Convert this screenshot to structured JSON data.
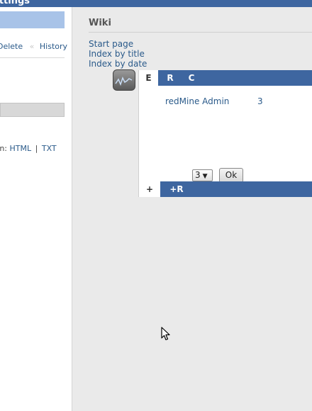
{
  "topbar": {
    "title": "ettings"
  },
  "left": {
    "actions": {
      "delete": "Delete",
      "history": "History"
    },
    "formats": {
      "prefix": "e in:",
      "html": "HTML",
      "txt": "TXT",
      "separator": "|"
    }
  },
  "sidebar": {
    "heading": "Wiki",
    "links": [
      "Start page",
      "Index by title",
      "Index by date"
    ]
  },
  "widget": {
    "icon": "line-chart-icon",
    "tabs": [
      "E",
      "R",
      "C"
    ],
    "active_tab": "E",
    "rows": [
      {
        "name": "redMine Admin",
        "count": "3"
      }
    ],
    "select_value": "3",
    "ok_label": "Ok",
    "footer_tabs": [
      "+",
      "+R"
    ]
  },
  "colors": {
    "header_blue": "#3e66a0",
    "sidebar_bg": "#eaeaea",
    "link": "#2a5a8a"
  }
}
